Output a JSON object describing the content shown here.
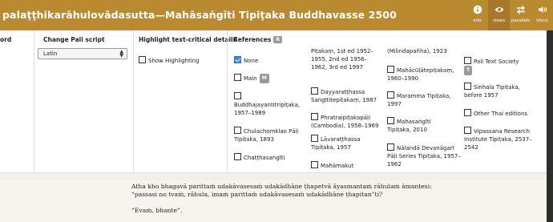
{
  "header": {
    "title": "palaṭṭhikarāhulovādasutta—Mahāsaṅgīti Tipiṭaka Buddhavasse 2500",
    "tools": [
      {
        "name": "info",
        "label": "info"
      },
      {
        "name": "views",
        "label": "views"
      },
      {
        "name": "parallels",
        "label": "parallels"
      },
      {
        "name": "voice",
        "label": "Voice"
      }
    ]
  },
  "columns": {
    "col1_head": "ord",
    "script_head": "Change Pali script",
    "script_value": "Latin",
    "highlight_head": "Highlight text-critical details",
    "highlight_label": "Show Highlighting",
    "references_head": "References",
    "references_badge": "R"
  },
  "references": {
    "none": "None",
    "main": "Main",
    "main_badge": "M",
    "buddhajayanti": "Buddhajayantitripiṭaka, 1957–1989",
    "chulachomklao": "Chulachomklao Pāḷi Tipiṭaka, 1893",
    "chatthasangiti": "Chaṭṭhasaṅgīti",
    "pitakam": "Piṭakaṃ, 1st ed 1952–1955, 2nd ed 1956–1962, 3rd ed 1997",
    "dayyarattha_sangiti": "Dayyaraṭṭhassa Saṅgītitepiṭakaṃ, 1987",
    "phratraipitaka": "Phratraipiṭakapāḷi (Cambodia), 1958–1969",
    "lavarattha": "Lāvaraṭṭhassa Tipiṭaka, 1957",
    "mahamakut": "Mahāmakut",
    "milindapanha": "(Milindapañha), 1923",
    "mahacula": "Mahācūḷātepiṭakaṃ, 1960–1990",
    "maramma": "Maramma Tipiṭaka, 1997",
    "mahasangiti": "Mahasaṅgīti Tipiṭaka, 2010",
    "nalanda": "Nālandā Devanāgarī Pāḷi Series Tipiṭaka, 1957–1962",
    "pts": "Pali Text Society",
    "pts_badge": "T",
    "sinhala": "Sinhala Tipiṭaka, before 1957",
    "other_thai": "Other Thai editions",
    "vipassana": "Vipassana Research Institute Tipiṭaka, 2537–2542"
  },
  "content": {
    "line1": "Atha kho bhagavā parittaṁ udakāvasesaṁ udakādhāne ṭhapetvā āyasmantaṁ rāhulaṁ āmantesi:",
    "line2": "“passasi no tvaṁ, rāhula, imaṁ parittaṁ udakāvasesaṁ udakādhāne ṭhapitan”ti?",
    "line3": "“Evaṁ, bhante”."
  },
  "colors": {
    "header_bg": "#b98a2f",
    "checkbox_checked": "#4a80c8",
    "content_bg": "#f7f4ee"
  }
}
